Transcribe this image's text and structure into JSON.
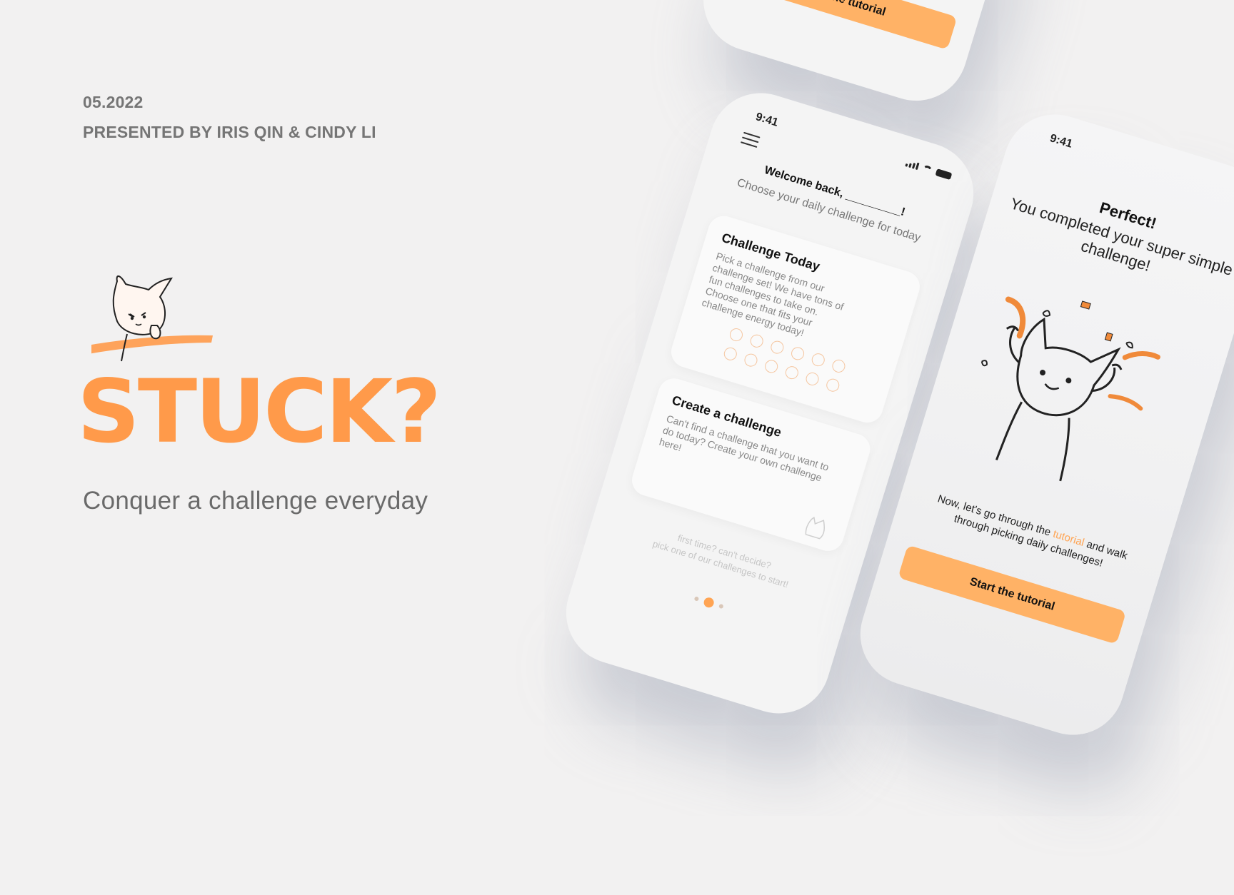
{
  "intro": {
    "date": "05.2022",
    "presenters": "PRESENTED BY IRIS QIN & CINDY  LI",
    "app_name": "STUCK?",
    "tagline": "Conquer a challenge everyday"
  },
  "colors": {
    "accent": "#ff9a4a",
    "button": "#ffb266",
    "background": "#f2f1f1"
  },
  "phone_home": {
    "time": "9:41",
    "welcome": "Welcome back, _________!",
    "subtitle": "Choose your daily challenge for today",
    "challenge_today": {
      "title": "Challenge Today",
      "description": "Pick a challenge from our challenge set! We have tons of fun challenges to take on. Choose one that fits your challenge energy today!"
    },
    "create_challenge": {
      "title": "Create a challenge",
      "description": "Can't find a challenge that you want to do today? Create your own challenge here!"
    },
    "hint_line1": "first time? can't decide?",
    "hint_line2": "pick one of our challenges to start!"
  },
  "phone_done": {
    "time": "9:41",
    "heading": "Perfect!",
    "subheading": "You completed your super simple challenge!",
    "tutorial_prefix": "Now, let's go through the ",
    "tutorial_link": "tutorial",
    "tutorial_suffix": " and walk through picking daily challenges!",
    "button": "Start the tutorial"
  },
  "phone_top": {
    "button": "Start the tutorial"
  }
}
